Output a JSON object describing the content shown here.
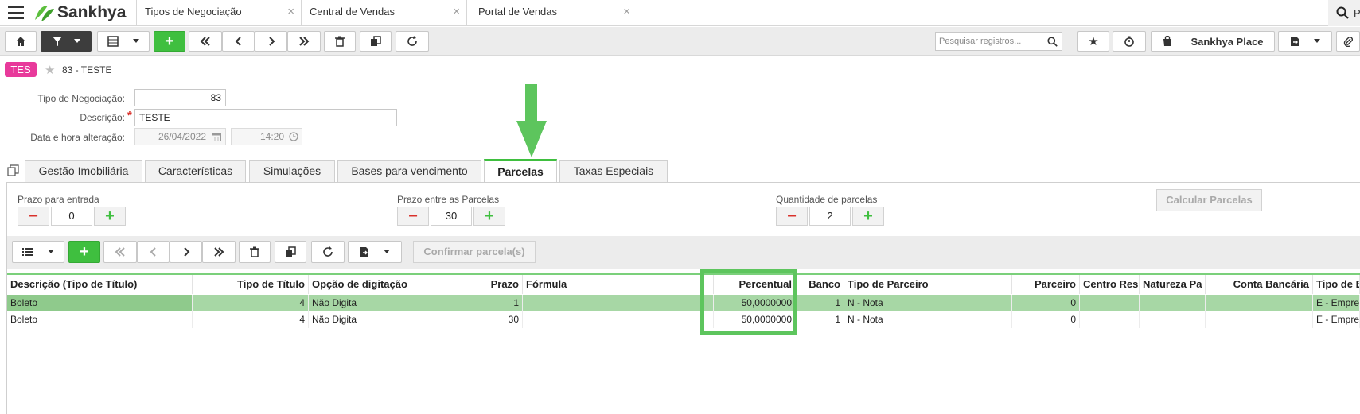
{
  "header": {
    "logo_text": "Sankhya",
    "tabs": [
      {
        "label": "Tipos de Negociação"
      },
      {
        "label": "Central de Vendas"
      },
      {
        "label": "Portal de Vendas"
      }
    ],
    "close_glyph": "×",
    "search_partial": "P"
  },
  "toolbar": {
    "search_placeholder": "Pesquisar registros...",
    "place_label": "Sankhya Place"
  },
  "record": {
    "badge": "TES",
    "title": "83 - TESTE"
  },
  "form": {
    "tipo_label": "Tipo de Negociação:",
    "tipo_value": "83",
    "descricao_label": "Descrição:",
    "descricao_required": "*",
    "descricao_value": "TESTE",
    "data_label": "Data e hora alteração:",
    "data_value": "26/04/2022",
    "hora_value": "14:20"
  },
  "tabs": [
    {
      "label": "Gestão Imobiliária"
    },
    {
      "label": "Características"
    },
    {
      "label": "Simulações"
    },
    {
      "label": "Bases para vencimento"
    },
    {
      "label": "Parcelas"
    },
    {
      "label": "Taxas Especiais"
    }
  ],
  "parcelas": {
    "entrada_label": "Prazo para entrada",
    "entrada_value": "0",
    "entre_label": "Prazo entre as Parcelas",
    "entre_value": "30",
    "quantidade_label": "Quantidade de parcelas",
    "quantidade_value": "2",
    "minus": "−",
    "plus": "+",
    "calcular_label": "Calcular Parcelas",
    "confirmar_label": "Confirmar parcela(s)"
  },
  "grid": {
    "columns": [
      "Descrição (Tipo de Título)",
      "Tipo de Título",
      "Opção de digitação",
      "Prazo",
      "Fórmula",
      "Percentual",
      "Banco",
      "Tipo de Parceiro",
      "Parceiro",
      "Centro Res",
      "Natureza Pa",
      "Conta Bancária",
      "Tipo de Er"
    ],
    "rows": [
      [
        "Boleto",
        "4",
        "Não Digita",
        "1",
        "",
        "50,0000000",
        "1",
        "N - Nota",
        "0",
        "",
        "",
        "",
        "E - Empres"
      ],
      [
        "Boleto",
        "4",
        "Não Digita",
        "30",
        "",
        "50,0000000",
        "1",
        "N - Nota",
        "0",
        "",
        "",
        "",
        "E - Empres"
      ]
    ]
  },
  "colors": {
    "accent_green": "#3fbf3f",
    "badge_pink": "#e83a9b",
    "annotation_green": "#5dc55d"
  }
}
